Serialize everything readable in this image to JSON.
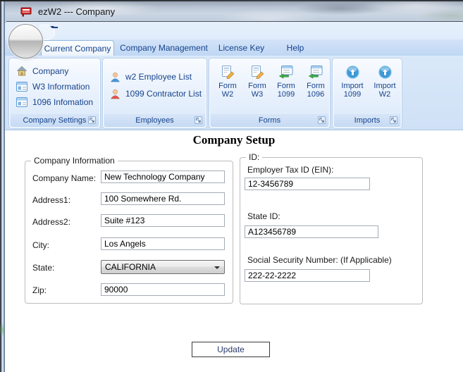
{
  "window": {
    "title": "ezW2 --- Company"
  },
  "tabs": [
    {
      "label": "Current Company",
      "selected": true
    },
    {
      "label": "Company Management",
      "selected": false
    },
    {
      "label": "License Key",
      "selected": false
    },
    {
      "label": "Help",
      "selected": false
    }
  ],
  "ribbon": {
    "groups": [
      {
        "name": "Company Settings",
        "items": [
          "Company",
          "W3 Information",
          "1096 Infomation"
        ]
      },
      {
        "name": "Employees",
        "items": [
          "w2 Employee List",
          "1099 Contractor List"
        ]
      },
      {
        "name": "Forms",
        "items": [
          "Form W2",
          "Form W3",
          "Form 1099",
          "Form 1096"
        ]
      },
      {
        "name": "Imports",
        "items": [
          "Import 1099",
          "Import W2"
        ]
      }
    ]
  },
  "page": {
    "heading": "Company Setup",
    "company_info": {
      "legend": "Company Information",
      "fields": [
        {
          "label": "Company Name:",
          "value": "New Technology Company",
          "type": "text"
        },
        {
          "label": "Address1:",
          "value": "100 Somewhere Rd.",
          "type": "text"
        },
        {
          "label": "Address2:",
          "value": "Suite #123",
          "type": "text"
        },
        {
          "label": "City:",
          "value": "Los Angels",
          "type": "text"
        },
        {
          "label": "State:",
          "value": "CALIFORNIA",
          "type": "select"
        },
        {
          "label": "Zip:",
          "value": "90000",
          "type": "text"
        }
      ]
    },
    "id_info": {
      "legend": "ID:",
      "fields": [
        {
          "label": "Employer Tax ID (EIN):",
          "value": "12-3456789"
        },
        {
          "label": "State ID:",
          "value": "A123456789"
        },
        {
          "label": "Social Security Number: (If Applicable)",
          "value": "222-22-2222"
        }
      ]
    },
    "update_button": "Update"
  },
  "colors": {
    "accent_navy": "#15428b",
    "ribbon_blue": "#d6e6f8",
    "title_icon_red": "#d42a2a",
    "employee_blue": "#4b97d9",
    "contractor_red": "#e05a4e",
    "pencil_orange": "#f0b24a",
    "arrow_green": "#3fae49",
    "import_blue": "#3e9bd9"
  }
}
